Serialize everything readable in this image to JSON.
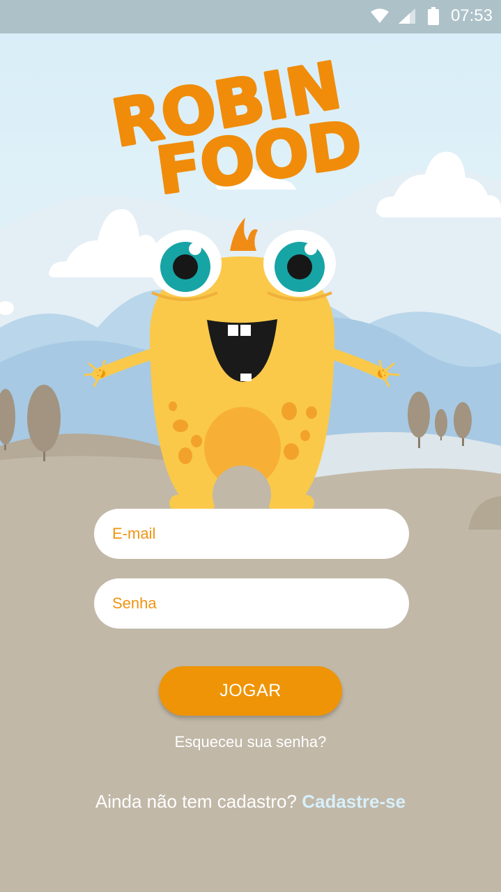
{
  "status_bar": {
    "time": "07:53",
    "icons": [
      "wifi-icon",
      "signal-icon",
      "battery-icon"
    ]
  },
  "logo": {
    "line1": "ROBIN",
    "line2": "FOOD"
  },
  "login": {
    "email_placeholder": "E-mail",
    "password_placeholder": "Senha",
    "submit_label": "JOGAR",
    "forgot_password": "Esqueceu sua senha?",
    "signup_prompt": "Ainda não tem cadastro?",
    "signup_link": "Cadastre-se"
  },
  "colors": {
    "accent": "#ef9406",
    "placeholder": "#ef9412",
    "ground": "#c1b8a8",
    "sky": "#dceff8",
    "status_bar": "#adc1c8",
    "monster": "#fac94a",
    "link": "#d7f0fb"
  }
}
